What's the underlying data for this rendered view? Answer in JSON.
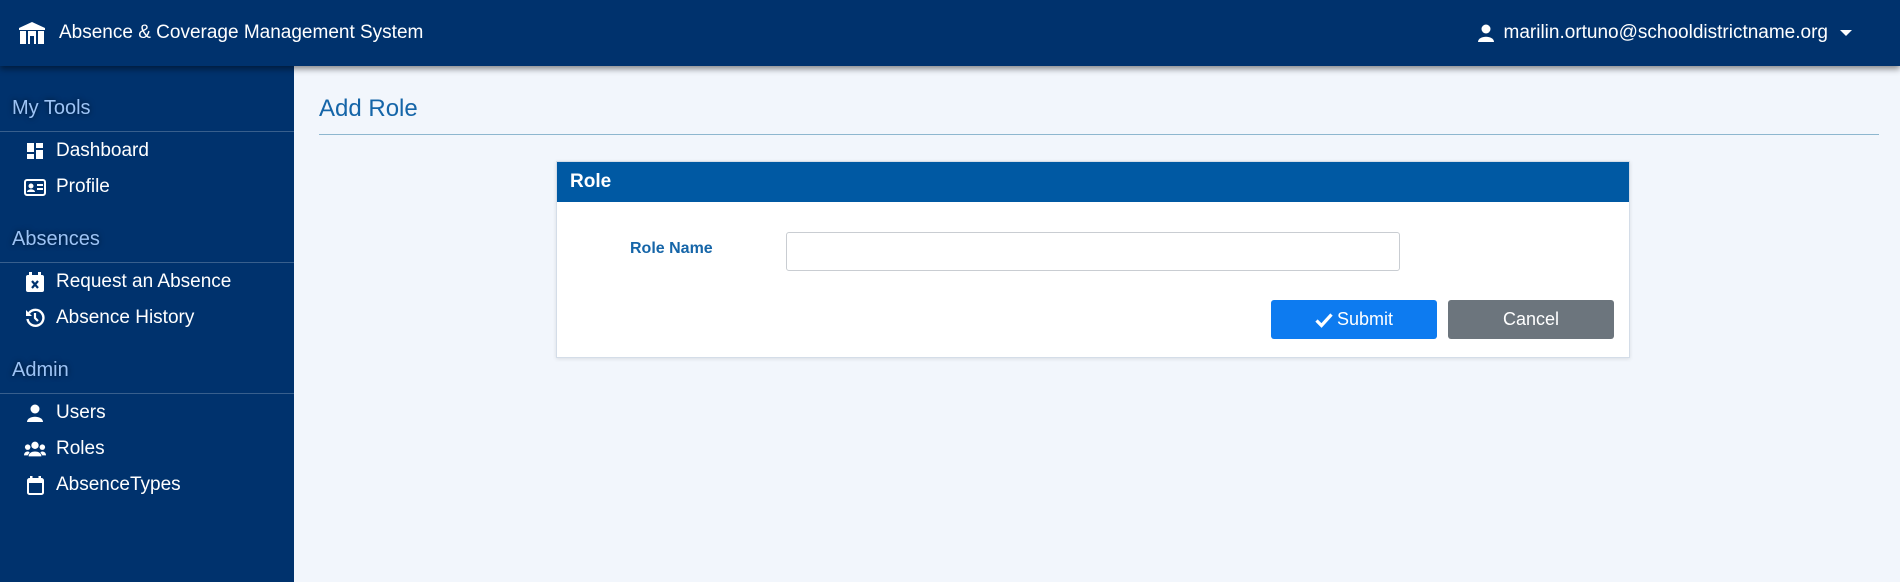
{
  "app": {
    "title": "Absence & Coverage Management System",
    "user_email": "marilin.ortuno@schooldistrictname.org"
  },
  "sidebar": {
    "sections": [
      {
        "title": "My Tools",
        "items": [
          {
            "label": "Dashboard",
            "icon": "dashboard-icon"
          },
          {
            "label": "Profile",
            "icon": "id-card-icon"
          }
        ]
      },
      {
        "title": "Absences",
        "items": [
          {
            "label": "Request an Absence",
            "icon": "calendar-x-icon"
          },
          {
            "label": "Absence History",
            "icon": "history-icon"
          }
        ]
      },
      {
        "title": "Admin",
        "items": [
          {
            "label": "Users",
            "icon": "user-icon"
          },
          {
            "label": "Roles",
            "icon": "users-group-icon"
          },
          {
            "label": "AbsenceTypes",
            "icon": "calendar-icon"
          }
        ]
      }
    ]
  },
  "main": {
    "page_title": "Add Role",
    "card": {
      "header": "Role",
      "field_label": "Role Name",
      "field_value": "",
      "submit_label": "Submit",
      "cancel_label": "Cancel"
    }
  },
  "colors": {
    "navy": "#00326d",
    "card_header": "#0059a3",
    "submit": "#0d7bf0",
    "cancel": "#6c757d",
    "accent_text": "#1565a8"
  }
}
